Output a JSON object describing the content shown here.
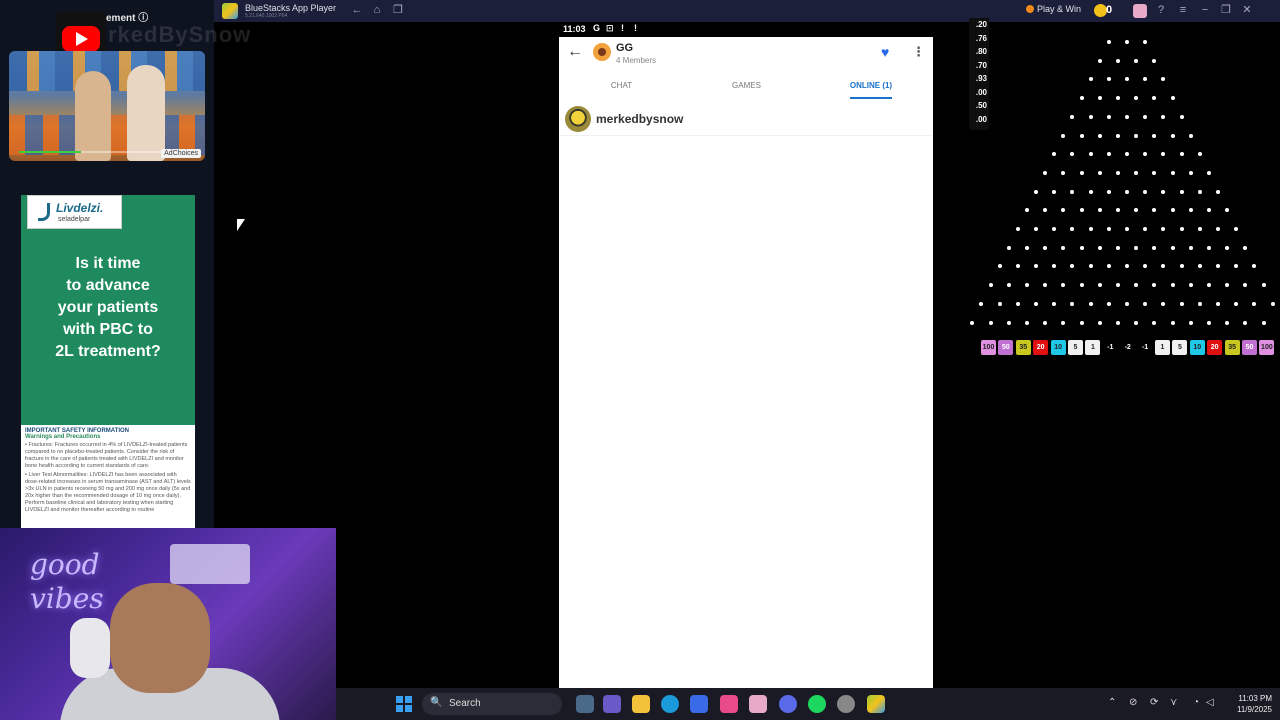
{
  "ad_panel": {
    "header": "ement ⓘ",
    "watermark": "rkedBySnow",
    "video": {
      "adchoices": "AdChoices",
      "progress": 0.35
    },
    "pharma": {
      "brand": "Livdelzi.",
      "generic": "seladelpar",
      "headline_lines": [
        "Is it time",
        "to advance",
        "your patients",
        "with PBC to",
        "2L treatment?"
      ],
      "safety_title": "IMPORTANT SAFETY INFORMATION",
      "safety_subtitle": "Warnings and Precautions",
      "safety_p1": "• Fractures: Fractures occurred in 4% of LIVDELZI-treated patients compared to no placebo-treated patients. Consider the risk of fracture in the care of patients treated with LIVDELZI and monitor bone health according to current standards of care.",
      "safety_p2": "• Liver Test Abnormalities: LIVDELZI has been associated with dose-related increases in serum transaminase (AST and ALT) levels >3x ULN in patients receiving 50 mg and 200 mg once daily (5x and 20x higher than the recommended dosage of 10 mg once daily). Perform baseline clinical and laboratory testing when starting LIVDELZI and monitor thereafter according to routine"
    }
  },
  "webcam": {
    "neon_line1": "good",
    "neon_line2": "vibes"
  },
  "bluestacks": {
    "title": "BlueStacks App Player",
    "version": "5.21.640.1002 P64",
    "play_win": "Play & Win",
    "coins": "0"
  },
  "phone": {
    "time": "11:03",
    "status_icons": [
      "G",
      "⊡",
      "!",
      "!"
    ],
    "group_name": "GG",
    "group_members": "4 Members",
    "tabs": [
      "CHAT",
      "GAMES",
      "ONLINE (1)"
    ],
    "active_tab": 2,
    "member_name": "merkedbysnow"
  },
  "scoreboard": [
    ".20",
    ".76",
    ".80",
    ".70",
    ".93",
    ".00",
    ".50",
    ".00"
  ],
  "plinko": {
    "slots": [
      "100",
      "50",
      "35",
      "20",
      "10",
      "5",
      "1",
      "-1",
      "-2",
      "-1",
      "1",
      "5",
      "10",
      "20",
      "35",
      "50",
      "100"
    ],
    "slot_colors": {
      "100": "#e090e0",
      "50": "#c070d0",
      "35": "#c8c820",
      "20": "#e01010",
      "10": "#20c8e8",
      "5": "#f0f0f0",
      "1": "#f0f0f0",
      "neg": "#000000"
    }
  },
  "taskbar": {
    "search_label": "Search",
    "time": "11:03 PM",
    "date": "11/9/2025"
  }
}
